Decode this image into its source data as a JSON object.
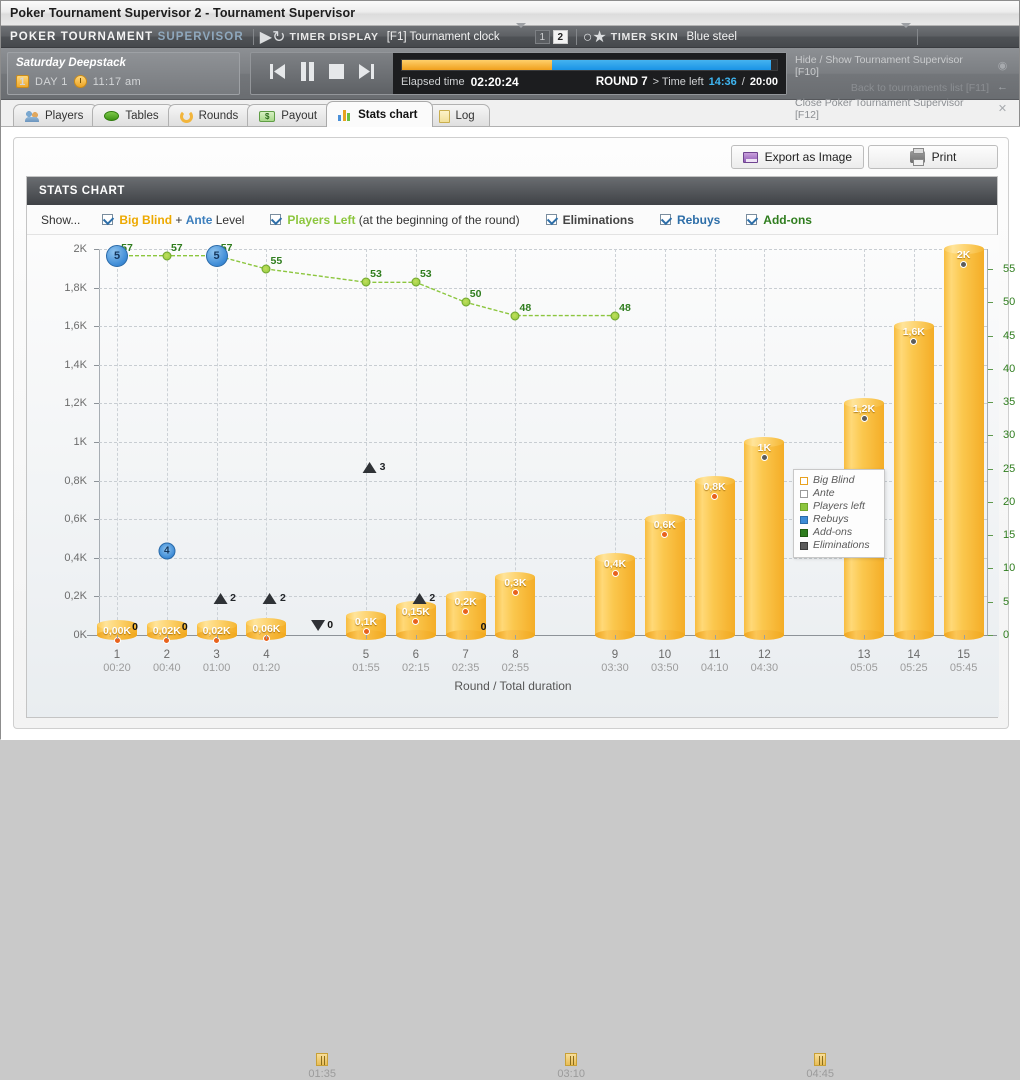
{
  "window": {
    "title": "Poker Tournament Supervisor 2 - Tournament Supervisor"
  },
  "appbar": {
    "brand_main": "POKER TOURNAMENT",
    "brand_sup": "SUPERVISOR",
    "timer_display_label": "TIMER DISPLAY",
    "timer_display_value": "[F1] Tournament clock",
    "page_1": "1",
    "page_2": "2",
    "timer_skin_label": "TIMER SKIN",
    "timer_skin_value": "Blue steel"
  },
  "tournament": {
    "name": "Saturday Deepstack",
    "day": "DAY 1",
    "day_num": "1",
    "time": "11:17 am",
    "elapsed_label": "Elapsed time",
    "elapsed_value": "02:20:24",
    "round_label": "ROUND 7",
    "time_left_prefix": "> Time left",
    "time_left": "14:36",
    "time_sep": "/",
    "round_duration": "20:00"
  },
  "side_links": [
    {
      "label": "Hide / Show Tournament Supervisor [F10]",
      "icon": "eye-icon"
    },
    {
      "label": "Back to tournaments list [F11]",
      "icon": "arrow-left-icon"
    },
    {
      "label": "Close Poker Tournament Supervisor [F12]",
      "icon": "close-icon"
    }
  ],
  "tabs": [
    {
      "label": "Players",
      "icon": "players-icon",
      "active": false
    },
    {
      "label": "Tables",
      "icon": "table-icon",
      "active": false
    },
    {
      "label": "Rounds",
      "icon": "rounds-icon",
      "active": false
    },
    {
      "label": "Payout",
      "icon": "payout-icon",
      "active": false
    },
    {
      "label": "Stats chart",
      "icon": "stats-icon",
      "active": true
    },
    {
      "label": "Log",
      "icon": "log-icon",
      "active": false
    }
  ],
  "toolbar": {
    "export_label": "Export as Image",
    "print_label": "Print"
  },
  "chart_panel": {
    "header": "STATS CHART",
    "show_label": "Show...",
    "options": [
      {
        "checked": true,
        "parts": [
          {
            "text": "Big Blind",
            "style": "bb"
          },
          {
            "text": " + ",
            "style": "plain"
          },
          {
            "text": "Ante",
            "style": "an"
          },
          {
            "text": " Level",
            "style": "plain"
          }
        ]
      },
      {
        "checked": true,
        "parts": [
          {
            "text": "Players Left",
            "style": "pl"
          },
          {
            "text": " (at the beginning of the round)",
            "style": "plain"
          }
        ]
      },
      {
        "checked": true,
        "parts": [
          {
            "text": "Eliminations",
            "style": "el"
          }
        ]
      },
      {
        "checked": true,
        "parts": [
          {
            "text": "Rebuys",
            "style": "rb"
          }
        ]
      },
      {
        "checked": true,
        "parts": [
          {
            "text": "Add-ons",
            "style": "ad"
          }
        ]
      }
    ]
  },
  "chart_data": {
    "type": "bar",
    "title": "STATS CHART",
    "xlabel": "Round / Total duration",
    "ylabel": "",
    "ylim": [
      0,
      2000
    ],
    "y2lim": [
      0,
      58
    ],
    "grid": true,
    "legend_position": "inside-top-right",
    "legend": [
      {
        "name": "Big Blind",
        "color": "#ffffff",
        "border": "#e8a11f"
      },
      {
        "name": "Ante",
        "color": "#ffffff",
        "border": "#9a9a9a"
      },
      {
        "name": "Players left",
        "color": "#8cc63e",
        "border": "#6fa52c"
      },
      {
        "name": "Rebuys",
        "color": "#3d8bd6",
        "border": "#2a6aa8"
      },
      {
        "name": "Add-ons",
        "color": "#2f7d1e",
        "border": "#1f5b12"
      },
      {
        "name": "Eliminations",
        "color": "#5c5c5c",
        "border": "#3b3b3b"
      }
    ],
    "categories": [
      "1",
      "2",
      "3",
      "4",
      "5",
      "6",
      "7",
      "8",
      "9",
      "10",
      "11",
      "12",
      "13",
      "14",
      "15"
    ],
    "durations": [
      "00:20",
      "00:40",
      "01:00",
      "01:20",
      "01:55",
      "02:15",
      "02:35",
      "02:55",
      "03:30",
      "03:50",
      "04:10",
      "04:30",
      "05:05",
      "05:25",
      "05:45"
    ],
    "breaks": [
      {
        "after_round": 4,
        "duration": "01:35"
      },
      {
        "after_round": 8,
        "duration": "03:10"
      },
      {
        "after_round": 12,
        "duration": "04:45"
      }
    ],
    "ytick_labels": [
      "0K",
      "0,2K",
      "0,4K",
      "0,6K",
      "0,8K",
      "1K",
      "1,2K",
      "1,4K",
      "1,6K",
      "1,8K",
      "2K"
    ],
    "ytick_values": [
      0,
      200,
      400,
      600,
      800,
      1000,
      1200,
      1400,
      1600,
      1800,
      2000
    ],
    "y2tick_labels": [
      "0",
      "5",
      "10",
      "15",
      "20",
      "25",
      "30",
      "35",
      "40",
      "45",
      "50",
      "55"
    ],
    "y2tick_values": [
      0,
      5,
      10,
      15,
      20,
      25,
      30,
      35,
      40,
      45,
      50,
      55
    ],
    "series": [
      {
        "name": "Big Blind",
        "type": "bar",
        "values": [
          20,
          25,
          25,
          60,
          100,
          150,
          200,
          300,
          400,
          600,
          800,
          1000,
          1200,
          1600,
          2000
        ],
        "labels": [
          "0,00K",
          "0,02K",
          "0,02K",
          "0,06K",
          "0,1K",
          "0,15K",
          "0,2K",
          "0,3K",
          "0,4K",
          "0,6K",
          "0,8K",
          "1K",
          "1,2K",
          "1,6K",
          "2K"
        ]
      },
      {
        "name": "Ante",
        "type": "bar-label",
        "labels": [
          "0",
          "0",
          "",
          "",
          "",
          "",
          "0",
          "",
          "",
          "",
          "",
          "",
          "",
          "",
          ""
        ]
      },
      {
        "name": "Players left",
        "type": "line",
        "values": [
          57,
          57,
          57,
          55,
          53,
          53,
          50,
          48,
          48
        ],
        "x_rounds": [
          1,
          2,
          3,
          4,
          5,
          6,
          7,
          8,
          9
        ]
      },
      {
        "name": "Rebuys",
        "type": "marker",
        "points": [
          {
            "round": 1,
            "value": 5
          },
          {
            "round": 2,
            "value": 4
          },
          {
            "round": 3,
            "value": 5
          }
        ]
      },
      {
        "name": "Eliminations",
        "type": "marker",
        "points": [
          {
            "round": 3,
            "value": 2
          },
          {
            "round": 4,
            "value": 2
          },
          {
            "round": 5,
            "value": 3
          },
          {
            "round": 6,
            "value": 2
          }
        ]
      },
      {
        "name": "Add-ons",
        "type": "marker",
        "points": [
          {
            "at_break": 1,
            "value": 0
          }
        ]
      }
    ]
  }
}
